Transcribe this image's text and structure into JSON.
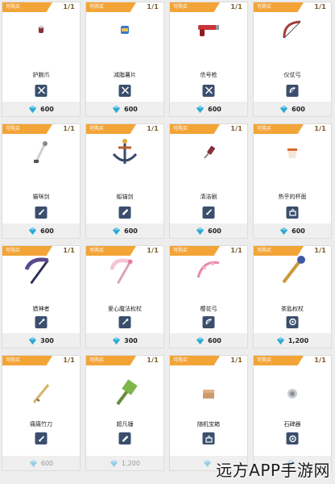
{
  "shop": {
    "items": [
      {
        "tag": "可购买",
        "count": "1/1",
        "name": "护腕爪",
        "price": "600",
        "icon": "gauntlet-icon",
        "type_icon": "crossed-swords-icon"
      },
      {
        "tag": "可购买",
        "count": "1/1",
        "name": "减脂薯片",
        "price": "600",
        "icon": "chips-icon",
        "type_icon": "crossed-swords-icon"
      },
      {
        "tag": "可购买",
        "count": "1/1",
        "name": "信号枪",
        "price": "600",
        "icon": "flare-gun-icon",
        "type_icon": "crossed-swords-icon"
      },
      {
        "tag": "可购买",
        "count": "1/1",
        "name": "仪仗弓",
        "price": "600",
        "icon": "bow-icon",
        "type_icon": "bow-icon"
      },
      {
        "tag": "可购买",
        "count": "1/1",
        "name": "猫咪剑",
        "price": "600",
        "icon": "cat-sword-icon",
        "type_icon": "sword-icon"
      },
      {
        "tag": "可购买",
        "count": "1/1",
        "name": "船锚剑",
        "price": "600",
        "icon": "anchor-icon",
        "type_icon": "greatsword-icon"
      },
      {
        "tag": "可购买",
        "count": "1/1",
        "name": "清洁剧",
        "price": "600",
        "icon": "brush-icon",
        "type_icon": "sword-icon"
      },
      {
        "tag": "可购买",
        "count": "1/1",
        "name": "热乎的杯面",
        "price": "600",
        "icon": "cup-noodle-icon",
        "type_icon": "basket-icon"
      },
      {
        "tag": "可购买",
        "count": "1/1",
        "name": "猎神者",
        "price": "300",
        "icon": "scythe-icon",
        "type_icon": "staff-icon"
      },
      {
        "tag": "可购买",
        "count": "1/1",
        "name": "爱心魔法权杖",
        "price": "300",
        "icon": "heart-scythe-icon",
        "type_icon": "staff-icon"
      },
      {
        "tag": "可购买",
        "count": "1/1",
        "name": "樱花弓",
        "price": "600",
        "icon": "sakura-bow-icon",
        "type_icon": "bow-icon"
      },
      {
        "tag": "可购买",
        "count": "1/1",
        "name": "茶匙权杖",
        "price": "1,200",
        "icon": "teaspoon-staff-icon",
        "type_icon": "orb-icon"
      },
      {
        "tag": "可购买",
        "count": "1/1",
        "name": "痛痛竹刀",
        "price": "600",
        "icon": "bamboo-sword-icon",
        "type_icon": "sword-icon"
      },
      {
        "tag": "可购买",
        "count": "1/1",
        "name": "超凡锤",
        "price": "1,200",
        "icon": "hammer-icon",
        "type_icon": "greatsword-icon"
      },
      {
        "tag": "可购买",
        "count": "1/1",
        "name": "随机宝箱",
        "price": "",
        "icon": "treasure-box-icon",
        "type_icon": "basket-icon"
      },
      {
        "tag": "可购买",
        "count": "1/1",
        "name": "石碑器",
        "price": "",
        "icon": "stone-disc-icon",
        "type_icon": "orb-icon"
      }
    ]
  },
  "watermark": "远方APP手游网",
  "colors": {
    "tag_bg": "#f3a437",
    "badge_bg": "#3b4f6d",
    "gem": "#2aa8d6",
    "count_num": "#f08a1a"
  }
}
